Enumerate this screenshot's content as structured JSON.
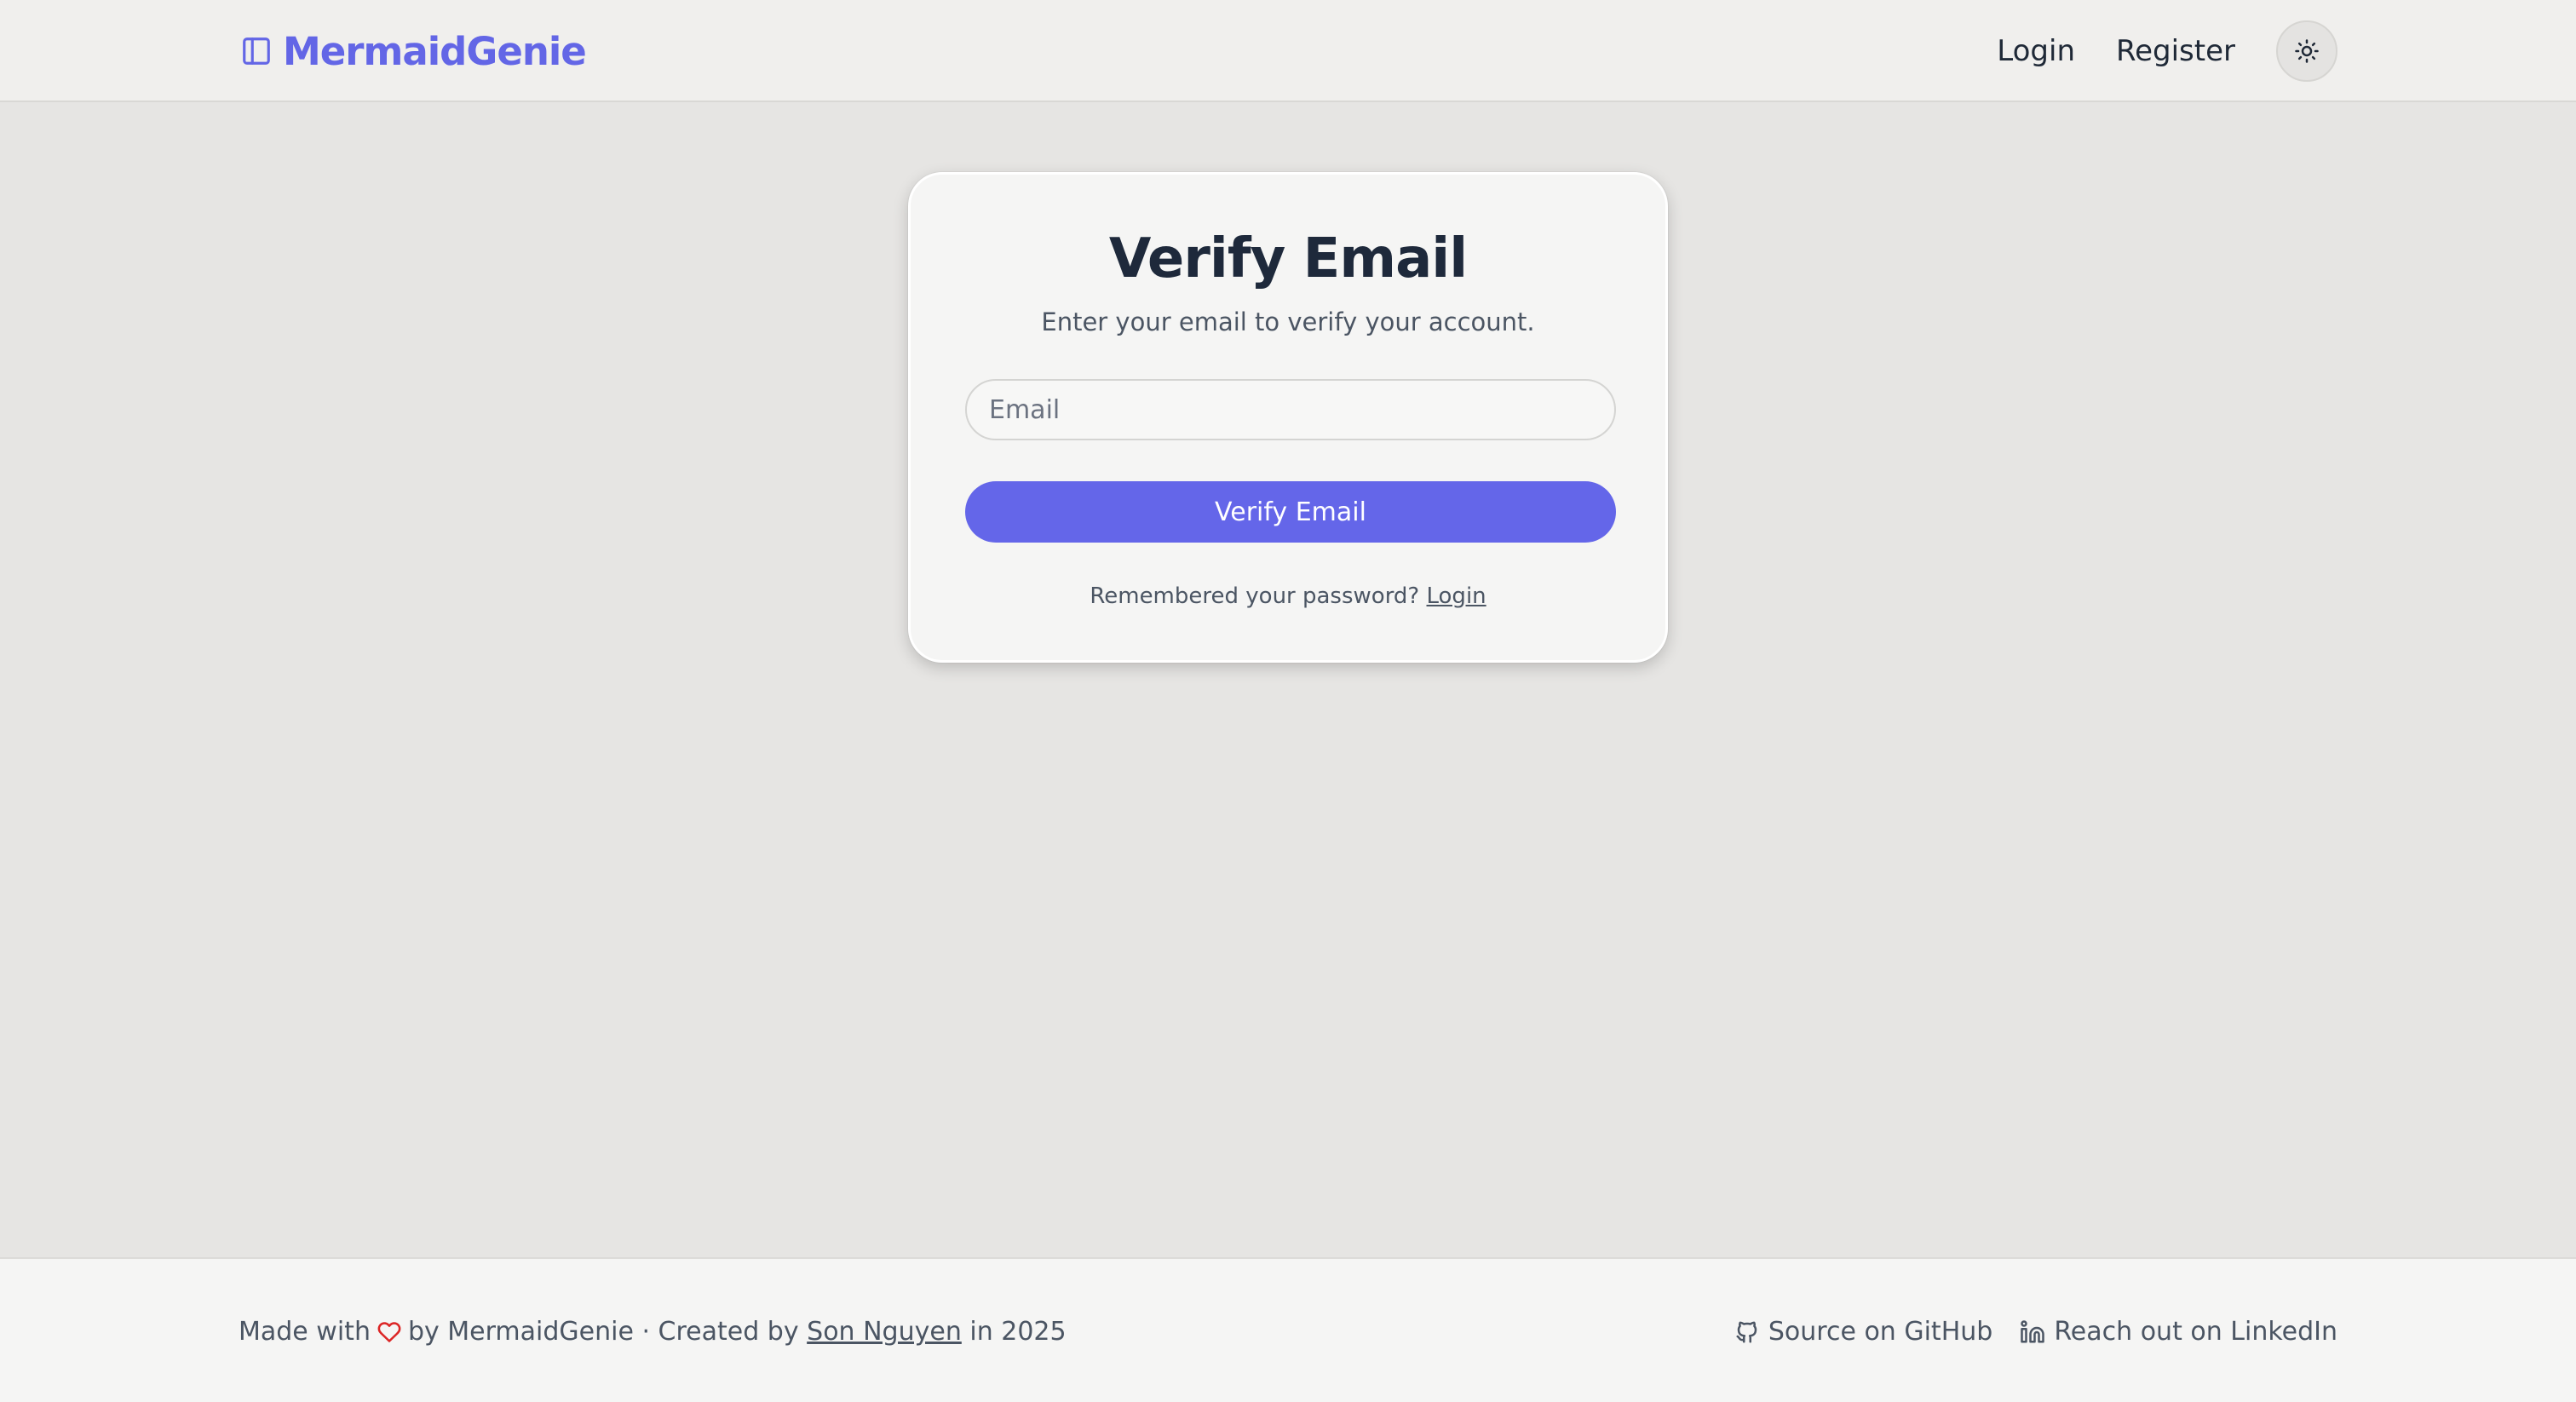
{
  "header": {
    "brand_name": "MermaidGenie",
    "brand_icon": "panel-left-icon",
    "nav": {
      "login_label": "Login",
      "register_label": "Register"
    },
    "theme_toggle_icon": "sun-icon"
  },
  "card": {
    "title": "Verify Email",
    "subtitle": "Enter your email to verify your account.",
    "email_input": {
      "value": "",
      "placeholder": "Email"
    },
    "submit_label": "Verify Email",
    "footer_prompt": "Remembered your password?",
    "footer_link_label": "Login"
  },
  "footer": {
    "made_with": "Made with",
    "heart_icon": "heart-icon",
    "by_text": "by MermaidGenie · Created by",
    "author_link": "Son Nguyen",
    "year_text": "in 2025",
    "github_label": "Source on GitHub",
    "github_icon": "github-icon",
    "linkedin_label": "Reach out on LinkedIn",
    "linkedin_icon": "linkedin-icon"
  },
  "colors": {
    "accent": "#6366e6",
    "button": "#6466e9",
    "background": "#e6e5e3",
    "card_background": "#f5f5f4",
    "heart": "#dc2626"
  }
}
